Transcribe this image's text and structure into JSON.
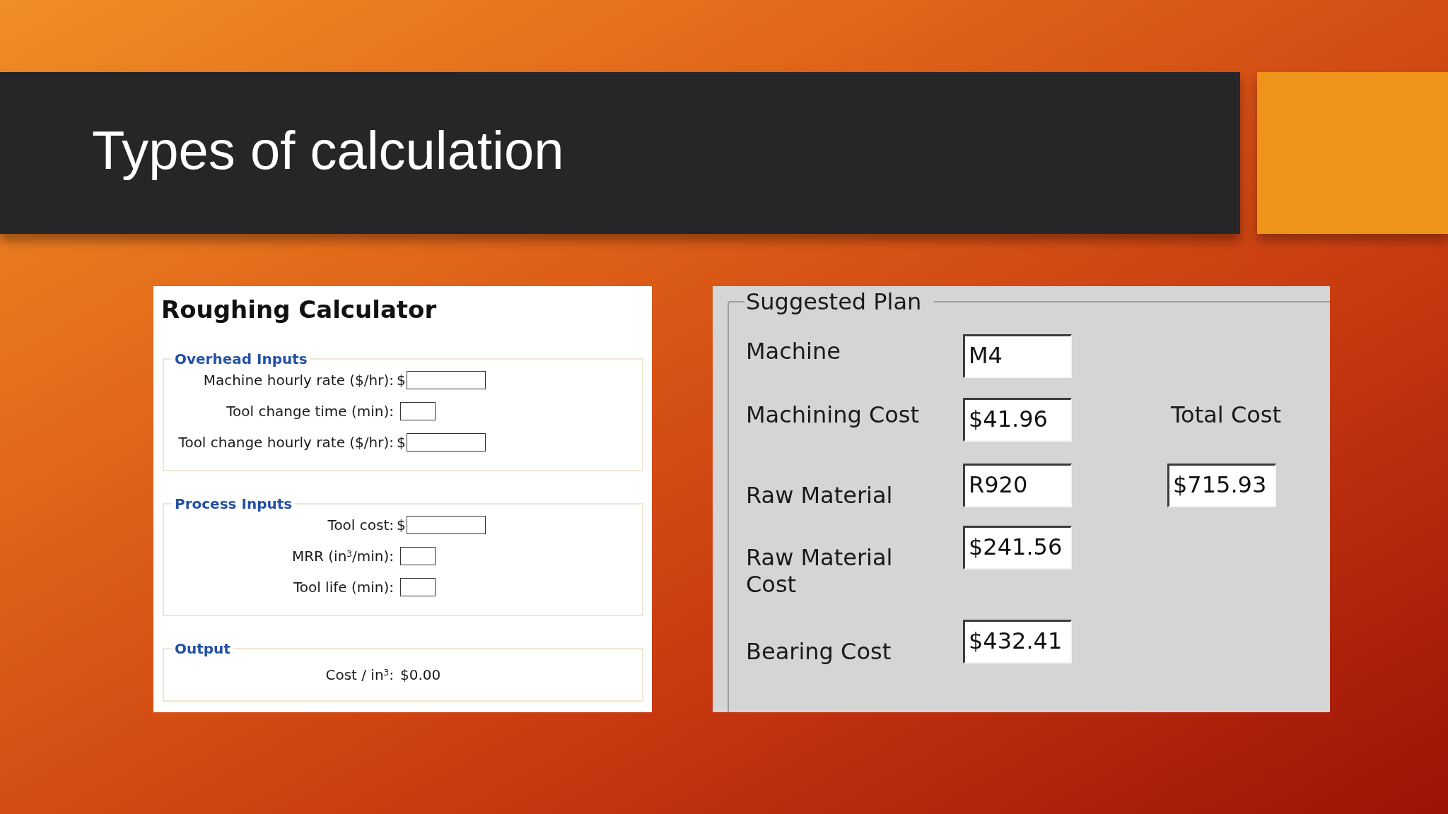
{
  "slide": {
    "title": "Types of calculation"
  },
  "roughing_calculator": {
    "title": "Roughing Calculator",
    "sections": [
      {
        "legend": "Overhead Inputs",
        "rows": [
          {
            "kind": "input",
            "label": "Machine hourly rate ($/hr):",
            "prefix": "$"
          },
          {
            "kind": "input",
            "label": "Tool change time (min):"
          },
          {
            "kind": "input",
            "label": "Tool change hourly rate ($/hr):",
            "prefix": "$"
          }
        ]
      },
      {
        "legend": "Process Inputs",
        "rows": [
          {
            "kind": "input",
            "label": "Tool cost:",
            "prefix": "$"
          },
          {
            "kind": "input",
            "label": "MRR (in$^{3}$/min):"
          },
          {
            "kind": "input",
            "label": "Tool life (min):"
          }
        ]
      },
      {
        "legend": "Output",
        "rows": [
          {
            "kind": "output",
            "label": "Cost / in$^{3}$:",
            "value": "$0.00"
          }
        ]
      }
    ]
  },
  "suggested_plan": {
    "title": "Suggested Plan",
    "fields": [
      {
        "label": "Machine",
        "value": "M4"
      },
      {
        "label": "Machining Cost",
        "value": "$41.96"
      },
      {
        "label": "Raw Material",
        "value": "R920"
      },
      {
        "label": "Raw Material Cost",
        "value": "$241.56"
      },
      {
        "label": "Bearing Cost",
        "value": "$432.41"
      }
    ],
    "total": {
      "label": "Total Cost",
      "value": "$715.93"
    }
  }
}
